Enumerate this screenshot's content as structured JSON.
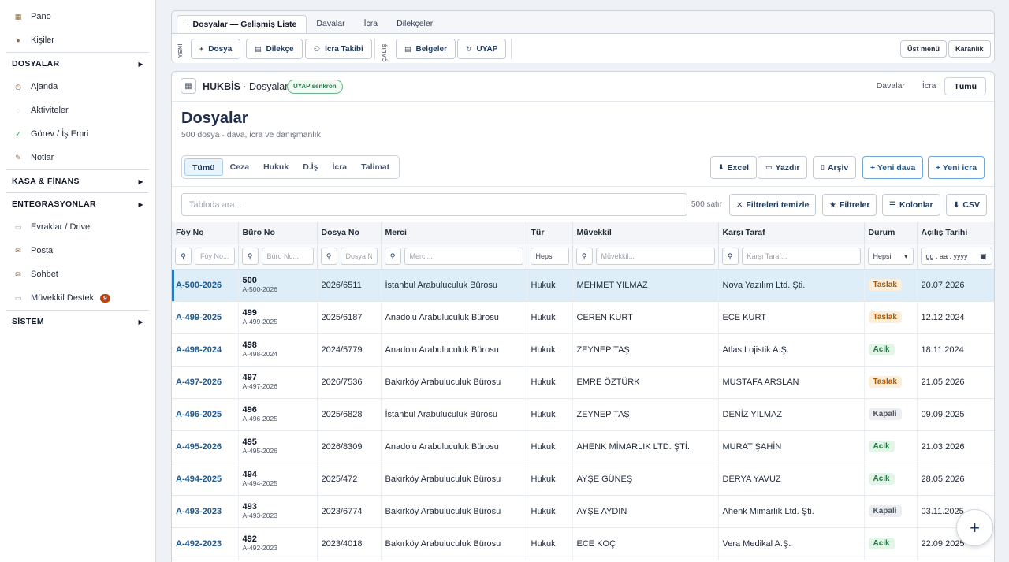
{
  "sidebar": {
    "top_items": [
      {
        "label": "Pano",
        "icon": "dashboard-icon"
      },
      {
        "label": "Kişiler",
        "icon": "people-icon"
      }
    ],
    "sections": [
      {
        "label": "DOSYALAR"
      },
      {
        "label": "KASA & FİNANS"
      },
      {
        "label": "ENTEGRASYONLAR"
      },
      {
        "label": "SİSTEM"
      }
    ],
    "dosyalar_items": [
      {
        "label": "Ajanda",
        "icon": "clock-icon"
      },
      {
        "label": "Aktiviteler",
        "icon": "activity-icon"
      },
      {
        "label": "Görev / İş Emri",
        "icon": "check-icon"
      },
      {
        "label": "Notlar",
        "icon": "pencil-icon"
      }
    ],
    "entegrasyon_items": [
      {
        "label": "Evraklar / Drive",
        "icon": "folder-icon"
      },
      {
        "label": "Posta",
        "icon": "mail-icon"
      },
      {
        "label": "Sohbet",
        "icon": "chat-icon"
      },
      {
        "label": "Müvekkil Destek",
        "icon": "support-icon",
        "badge": "9"
      }
    ]
  },
  "toolbar": {
    "tabs": [
      "Dosyalar — Gelişmiş Liste",
      "Davalar",
      "İcra",
      "Dilekçeler"
    ],
    "group1_label": "YENİ",
    "group2_label": "ÇALIŞ",
    "buttons": {
      "dosya": "Dosya",
      "dilekce": "Dilekçe",
      "icra_takibi": "İcra Takibi",
      "belgeler": "Belgeler",
      "uyap": "UYAP"
    },
    "ust_menu": "Üst menü",
    "karanlik": "Karanlık"
  },
  "main": {
    "header_title": "HUKBİS",
    "header_sub": " · Dosyalar",
    "sync_badge": "UYAP senkron",
    "header_tabs": [
      "Davalar",
      "İcra",
      "Tümü"
    ],
    "page_title": "Dosyalar",
    "page_sub": "500 dosya · dava, icra ve danışmanlık",
    "segments": [
      "Tümü",
      "Ceza",
      "Hukuk",
      "D.İş",
      "İcra",
      "Talimat"
    ],
    "actions": {
      "excel": "Excel",
      "yazdir": "Yazdır",
      "arsiv": "Arşiv",
      "yeni_dava": "+ Yeni dava",
      "yeni_icra": "+ Yeni icra"
    },
    "search_placeholder": "Tabloda ara...",
    "rows_count": "500 satır",
    "filter_buttons": {
      "temizle": "Filtreleri temizle",
      "filtreler": "Filtreler",
      "kolonlar": "Kolonlar",
      "csv": "CSV"
    }
  },
  "table": {
    "columns": [
      "Föy No",
      "Büro No",
      "Dosya No",
      "Merci",
      "Tür",
      "Müvekkil",
      "Karşı Taraf",
      "Durum",
      "Açılış Tarihi"
    ],
    "filter_placeholders": {
      "foy": "Föy No...",
      "buro": "Büro No...",
      "dosya": "Dosya No...",
      "merci": "Merci...",
      "tur": "Hepsi",
      "muvekkil": "Müvekkil...",
      "karsi": "Karşı Taraf...",
      "durum": "Hepsi",
      "tarih": "gg . aa . yyyy"
    },
    "rows": [
      {
        "foy": "A-500-2026",
        "buro_n": "500",
        "buro_s": "A-500-2026",
        "dosya": "2026/6511",
        "merci": "İstanbul Arabuluculuk Bürosu",
        "tur": "Hukuk",
        "muvekkil": "MEHMET YILMAZ",
        "karsi": "Nova Yazılım Ltd. Şti.",
        "durum": "Taslak",
        "tarih": "20.07.2026"
      },
      {
        "foy": "A-499-2025",
        "buro_n": "499",
        "buro_s": "A-499-2025",
        "dosya": "2025/6187",
        "merci": "Anadolu Arabuluculuk Bürosu",
        "tur": "Hukuk",
        "muvekkil": "CEREN KURT",
        "karsi": "ECE KURT",
        "durum": "Taslak",
        "tarih": "12.12.2024"
      },
      {
        "foy": "A-498-2024",
        "buro_n": "498",
        "buro_s": "A-498-2024",
        "dosya": "2024/5779",
        "merci": "Anadolu Arabuluculuk Bürosu",
        "tur": "Hukuk",
        "muvekkil": "ZEYNEP TAŞ",
        "karsi": "Atlas Lojistik A.Ş.",
        "durum": "Acik",
        "tarih": "18.11.2024"
      },
      {
        "foy": "A-497-2026",
        "buro_n": "497",
        "buro_s": "A-497-2026",
        "dosya": "2026/7536",
        "merci": "Bakırköy Arabuluculuk Bürosu",
        "tur": "Hukuk",
        "muvekkil": "EMRE ÖZTÜRK",
        "karsi": "MUSTAFA ARSLAN",
        "durum": "Taslak",
        "tarih": "21.05.2026"
      },
      {
        "foy": "A-496-2025",
        "buro_n": "496",
        "buro_s": "A-496-2025",
        "dosya": "2025/6828",
        "merci": "İstanbul Arabuluculuk Bürosu",
        "tur": "Hukuk",
        "muvekkil": "ZEYNEP TAŞ",
        "karsi": "DENİZ YILMAZ",
        "durum": "Kapali",
        "tarih": "09.09.2025"
      },
      {
        "foy": "A-495-2026",
        "buro_n": "495",
        "buro_s": "A-495-2026",
        "dosya": "2026/8309",
        "merci": "Anadolu Arabuluculuk Bürosu",
        "tur": "Hukuk",
        "muvekkil": "AHENK MİMARLIK LTD. ŞTİ.",
        "karsi": "MURAT ŞAHİN",
        "durum": "Acik",
        "tarih": "21.03.2026"
      },
      {
        "foy": "A-494-2025",
        "buro_n": "494",
        "buro_s": "A-494-2025",
        "dosya": "2025/472",
        "merci": "Bakırköy Arabuluculuk Bürosu",
        "tur": "Hukuk",
        "muvekkil": "AYŞE GÜNEŞ",
        "karsi": "DERYA YAVUZ",
        "durum": "Acik",
        "tarih": "28.05.2026"
      },
      {
        "foy": "A-493-2023",
        "buro_n": "493",
        "buro_s": "A-493-2023",
        "dosya": "2023/6774",
        "merci": "Bakırköy Arabuluculuk Bürosu",
        "tur": "Hukuk",
        "muvekkil": "AYŞE AYDIN",
        "karsi": "Ahenk Mimarlık Ltd. Şti.",
        "durum": "Kapali",
        "tarih": "03.11.2025"
      },
      {
        "foy": "A-492-2023",
        "buro_n": "492",
        "buro_s": "A-492-2023",
        "dosya": "2023/4018",
        "merci": "Bakırköy Arabuluculuk Bürosu",
        "tur": "Hukuk",
        "muvekkil": "ECE KOÇ",
        "karsi": "Vera Medikal A.Ş.",
        "durum": "Acik",
        "tarih": "22.09.2025"
      }
    ]
  },
  "colors": {
    "accent": "#1e5b92",
    "selected_row": "#ddeef8",
    "taslak": "#a35b0b",
    "acik": "#1f7a3e",
    "kapali": "#4b5563"
  }
}
